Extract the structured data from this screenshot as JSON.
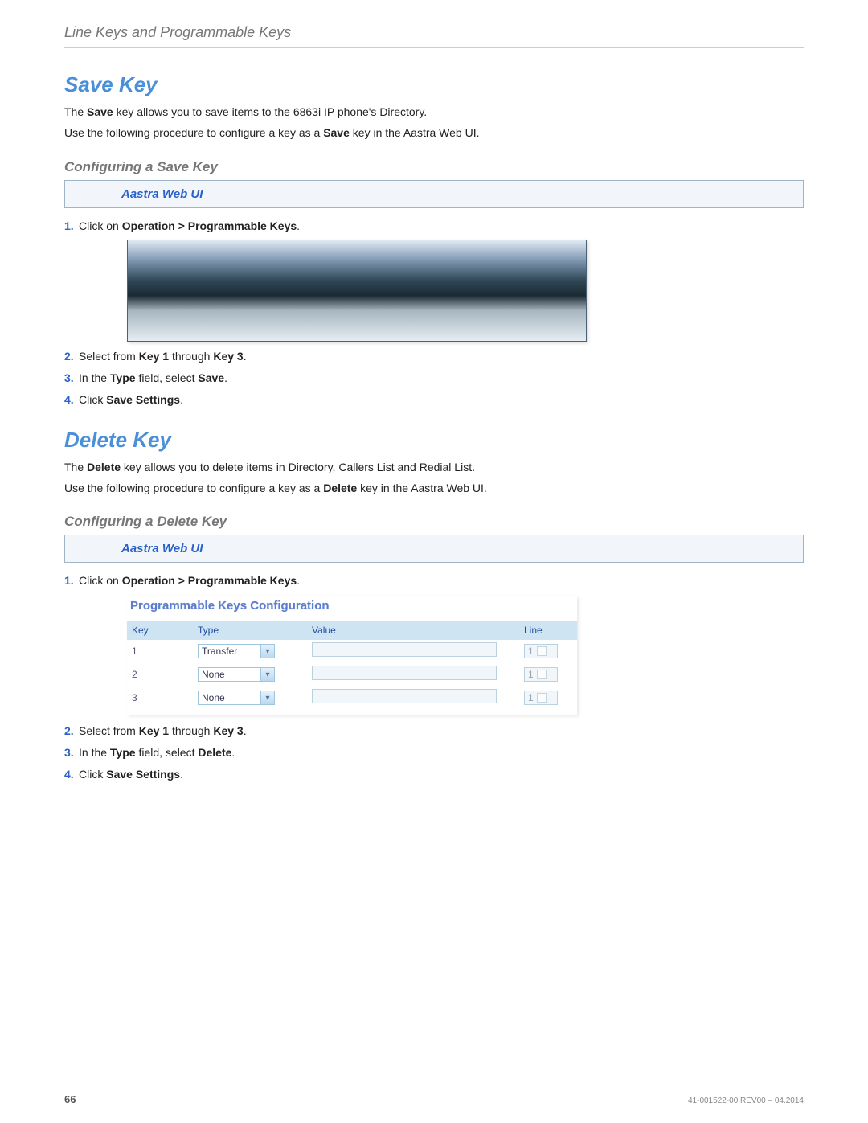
{
  "header": {
    "running": "Line Keys and Programmable Keys"
  },
  "save": {
    "title": "Save Key",
    "p1a": "The ",
    "p1b": "Save",
    "p1c": " key allows you to save items to the 6863i IP phone's Directory.",
    "p2a": "Use the following procedure to configure a key as a ",
    "p2b": "Save",
    "p2c": " key in the Aastra Web UI.",
    "sub": "Configuring a Save Key",
    "uibox": "Aastra Web UI",
    "s1a": "Click on ",
    "s1b": "Operation > Programmable Keys",
    "s1c": ".",
    "s2a": "Select from ",
    "s2b": "Key 1",
    "s2c": " through ",
    "s2d": "Key 3",
    "s2e": ".",
    "s3a": "In the ",
    "s3b": "Type",
    "s3c": " field, select ",
    "s3d": "Save",
    "s3e": ".",
    "s4a": "Click ",
    "s4b": "Save Settings",
    "s4c": "."
  },
  "delete": {
    "title": "Delete Key",
    "p1a": "The ",
    "p1b": "Delete",
    "p1c": " key allows you to delete items in Directory, Callers List and Redial List.",
    "p2a": "Use the following procedure to configure a key as a ",
    "p2b": "Delete",
    "p2c": " key in the Aastra Web UI.",
    "sub": "Configuring a Delete Key",
    "uibox": "Aastra Web UI",
    "s1a": "Click on ",
    "s1b": "Operation > Programmable Keys",
    "s1c": ".",
    "s2a": "Select from ",
    "s2b": "Key 1",
    "s2c": " through ",
    "s2d": "Key 3",
    "s2e": ".",
    "s3a": "In the ",
    "s3b": "Type",
    "s3c": " field, select ",
    "s3d": "Delete",
    "s3e": ".",
    "s4a": "Click ",
    "s4b": "Save Settings",
    "s4c": "."
  },
  "cfg": {
    "title": "Programmable Keys Configuration",
    "cols": {
      "key": "Key",
      "type": "Type",
      "value": "Value",
      "line": "Line"
    },
    "rows": [
      {
        "key": "1",
        "type": "Transfer",
        "line": "1"
      },
      {
        "key": "2",
        "type": "None",
        "line": "1"
      },
      {
        "key": "3",
        "type": "None",
        "line": "1"
      }
    ]
  },
  "numbers": {
    "n1": "1.",
    "n2": "2.",
    "n3": "3.",
    "n4": "4."
  },
  "footer": {
    "page": "66",
    "docid": "41-001522-00 REV00 – 04.2014"
  }
}
